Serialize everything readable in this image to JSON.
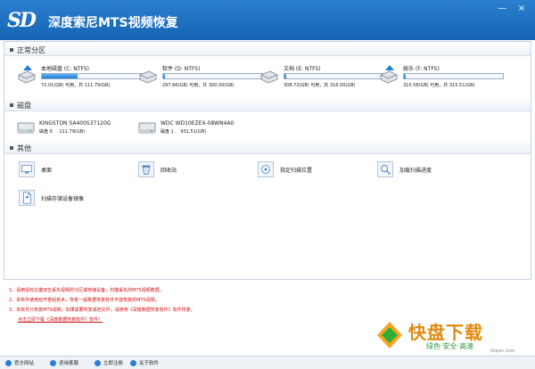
{
  "app": {
    "title": "深度索尼MTS视频恢复",
    "logo_text": "SD"
  },
  "window_controls": {
    "minimize": "—",
    "close": "×"
  },
  "sections": {
    "partitions": "正常分区",
    "disks": "磁盘",
    "other": "其他"
  },
  "partitions": [
    {
      "name": "本地磁盘 (C: NTFS)",
      "size": "72.01(GB) 可用，共 111.79(GB)",
      "used_fraction": 0.36
    },
    {
      "name": "软件 (D: NTFS)",
      "size": "297.96(GB) 可用，共 300.00(GB)",
      "used_fraction": 0.01
    },
    {
      "name": "文档 (E: NTFS)",
      "size": "308.72(GB) 可用，共 316.00(GB)",
      "used_fraction": 0.02
    },
    {
      "name": "娱乐 (F: NTFS)",
      "size": "310.58(GB) 可用，共 315.51(GB)",
      "used_fraction": 0.02
    }
  ],
  "disks": [
    {
      "name": "KINGSTON SA400S37120G",
      "sub_label": "磁盘 0",
      "size": "111.79(GB)"
    },
    {
      "name": "WDC WD10EZEX-08WN4A0",
      "sub_label": "磁盘 1",
      "size": "931.51(GB)"
    }
  ],
  "tools": [
    {
      "label": "桌面",
      "icon": "desktop-icon"
    },
    {
      "label": "回收站",
      "icon": "recycle-bin-icon"
    },
    {
      "label": "指定扫描位置",
      "icon": "target-location-icon"
    },
    {
      "label": "加载扫描进度",
      "icon": "load-progress-icon"
    },
    {
      "label": "扫描存储设备镜像",
      "icon": "image-file-icon"
    }
  ],
  "notes": [
    "1、请用鼠标左键双击丢失视频的分区或存储设备，扫描丢失的MTS视频数据。",
    "2、本软件使用双开重组技术，恢复一般数据恢复软件不能恢复的MTS视频。",
    "3、本软件只恢复MTS视频。如果需要恢复其他文件，请使用《深度数据恢复软件》软件恢复。",
    "点击立即下载《深度数据恢复软件》软件！"
  ],
  "statusbar": [
    "官方网站",
    "咨询客服",
    "立即注册",
    "关于软件"
  ],
  "watermark": {
    "brand": "快盘下载",
    "slogan": "绿色·安全·高速",
    "site": "kkpan.com"
  },
  "colors": {
    "titlebar": "#1e6ab0",
    "accent": "#1f7fd8",
    "note": "#d01010"
  }
}
